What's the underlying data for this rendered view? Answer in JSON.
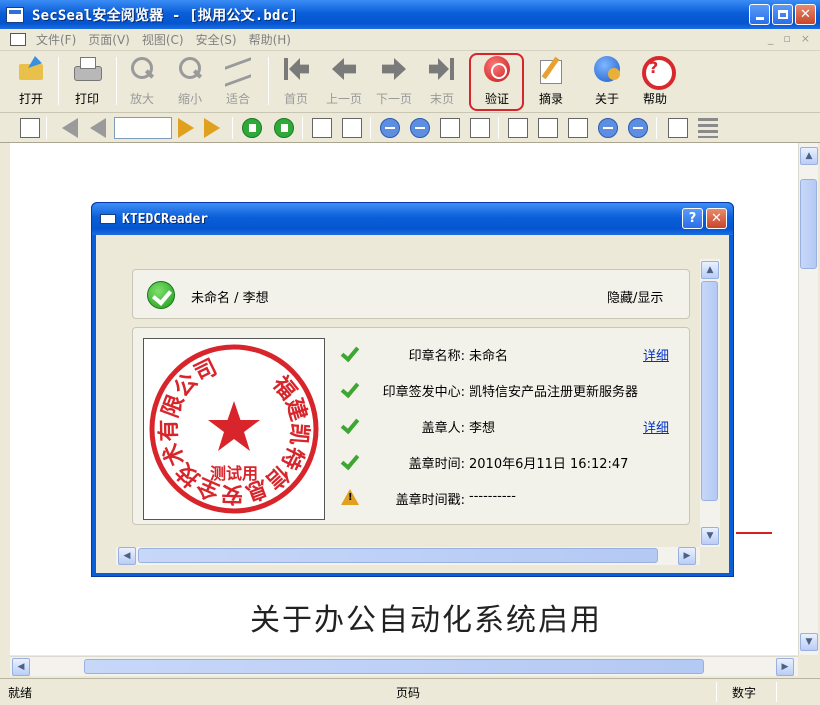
{
  "window": {
    "title": "SecSeal安全阅览器 - [拟用公文.bdc]"
  },
  "menu": {
    "items": [
      "文件(F)",
      "页面(V)",
      "视图(C)",
      "安全(S)",
      "帮助(H)"
    ]
  },
  "toolbar": {
    "open": "打开",
    "print": "打印",
    "zoom_in": "放大",
    "zoom_out": "缩小",
    "fit": "适合",
    "first_page": "首页",
    "prev_page": "上一页",
    "next_page": "下一页",
    "last_page": "末页",
    "verify": "验证",
    "abstract": "摘录",
    "about": "关于",
    "help": "帮助"
  },
  "navbar": {
    "page_value": ""
  },
  "document": {
    "heading": "关于办公自动化系统启用"
  },
  "statusbar": {
    "ready": "就绪",
    "page": "页码",
    "num": "数字"
  },
  "dialog": {
    "title": "KTEDCReader",
    "summary": {
      "signer": "未命名 / 李想",
      "toggle": "隐藏/显示"
    },
    "seal": {
      "ring_text": "福建凯特信息安全技术有限公司",
      "center_text": "测试用"
    },
    "rows": [
      {
        "label": "印章名称:",
        "value": "未命名",
        "link": "详细",
        "status": "ok"
      },
      {
        "label": "印章签发中心:",
        "value": "凯特信安产品注册更新服务器",
        "link": "",
        "status": "ok"
      },
      {
        "label": "盖章人:",
        "value": "李想",
        "link": "详细",
        "status": "ok"
      },
      {
        "label": "盖章时间:",
        "value": "2010年6月11日 16:12:47",
        "link": "",
        "status": "ok"
      },
      {
        "label": "盖章时间戳:",
        "value": "----------",
        "link": "",
        "status": "warn"
      }
    ]
  },
  "colors": {
    "xp_blue": "#0a5fd8",
    "seal_red": "#d8252b",
    "ok_green": "#3ea734"
  }
}
